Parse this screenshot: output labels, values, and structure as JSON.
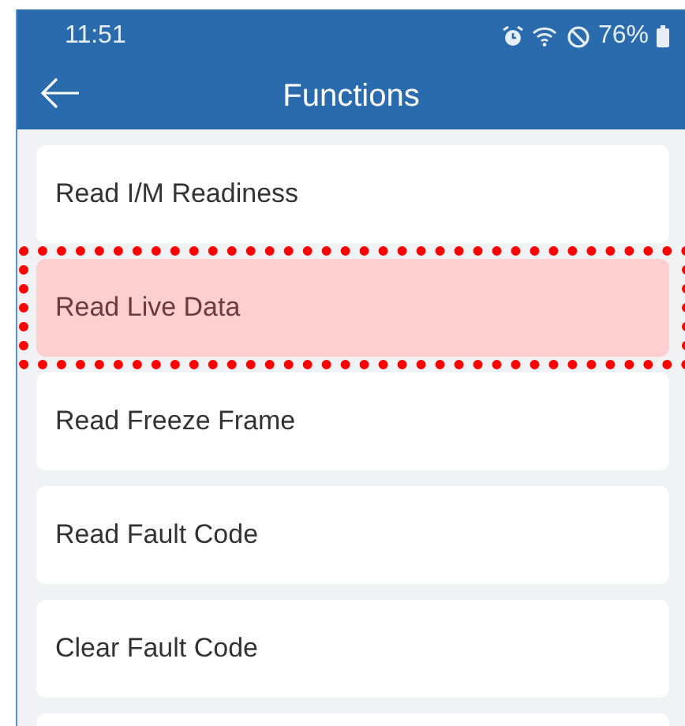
{
  "status_bar": {
    "time": "11:51",
    "battery": "76%"
  },
  "header": {
    "title": "Functions"
  },
  "functions": [
    {
      "label": "Read I/M Readiness",
      "selected": false
    },
    {
      "label": "Read Live Data",
      "selected": true
    },
    {
      "label": "Read Freeze Frame",
      "selected": false
    },
    {
      "label": "Read Fault Code",
      "selected": false
    },
    {
      "label": "Clear Fault Code",
      "selected": false
    }
  ]
}
